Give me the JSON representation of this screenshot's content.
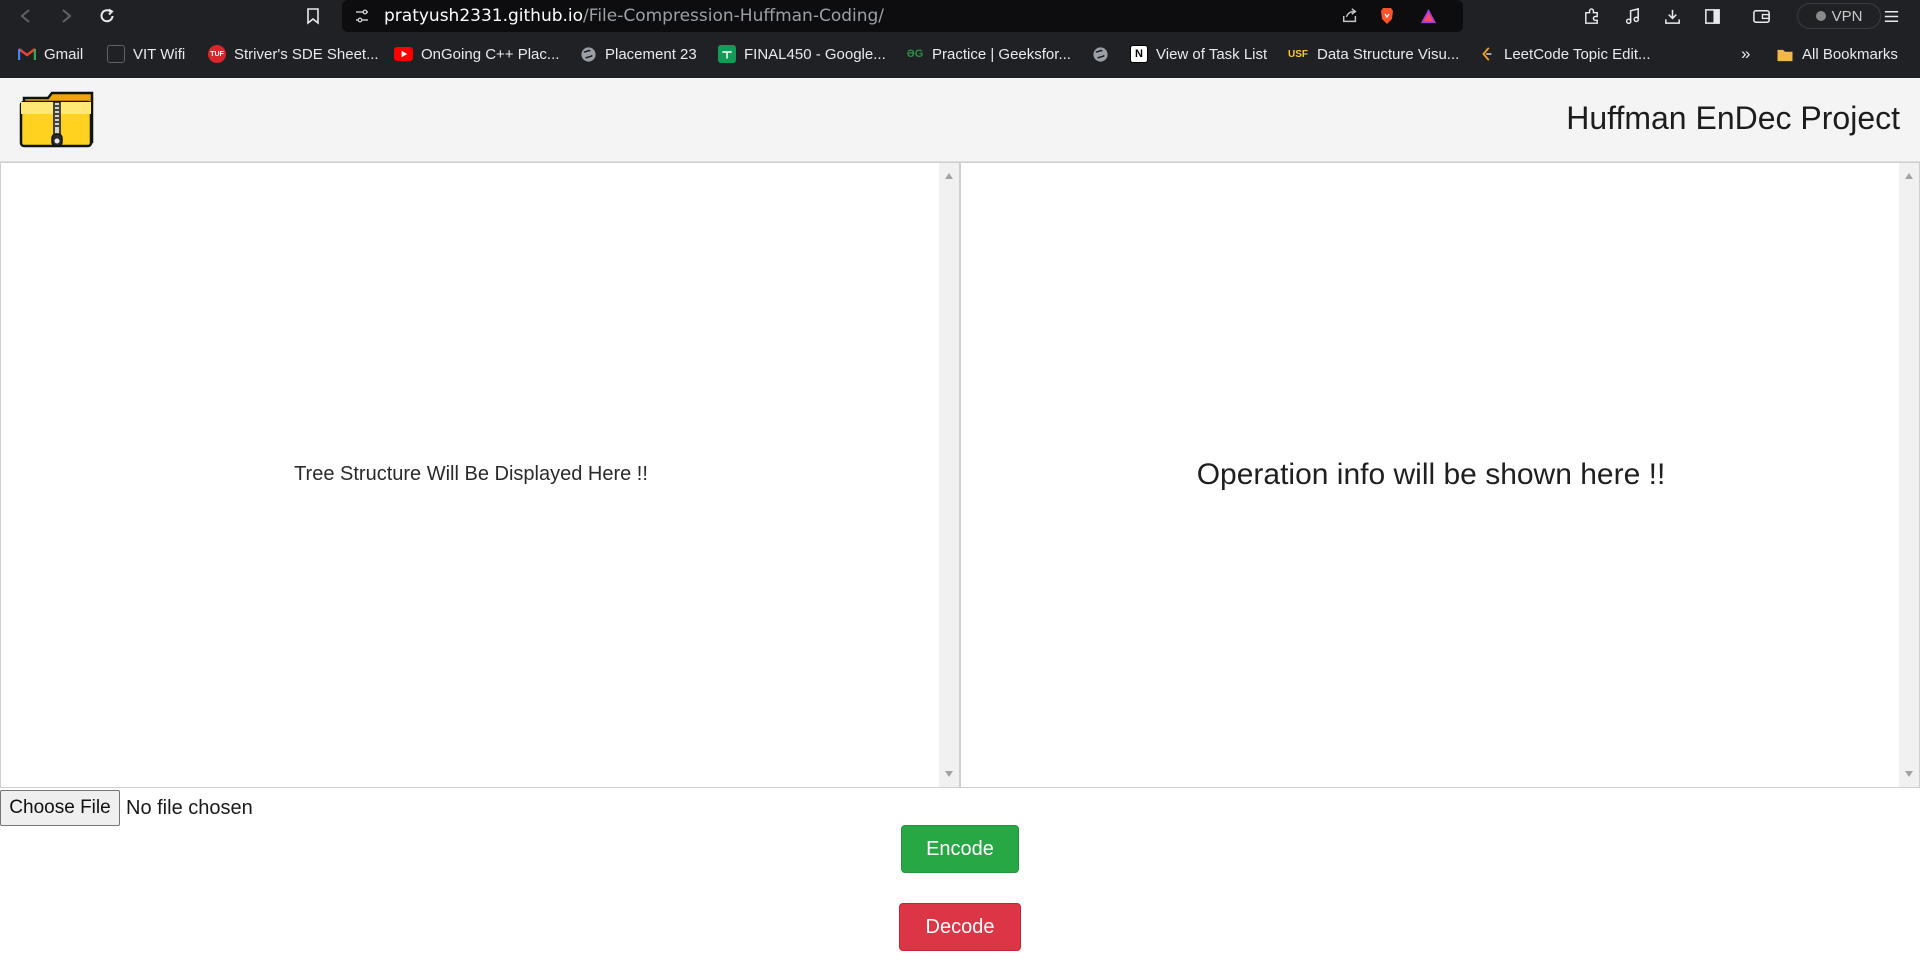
{
  "browser": {
    "url_domain": "pratyush2331.github.io",
    "url_path": "/File-Compression-Huffman-Coding/",
    "vpn_label": "VPN",
    "bookmarks": [
      {
        "label": "Gmail"
      },
      {
        "label": "VIT Wifi"
      },
      {
        "label": "Striver's SDE Sheet..."
      },
      {
        "label": "OnGoing C++ Plac..."
      },
      {
        "label": "Placement 23"
      },
      {
        "label": "FINAL450 - Google..."
      },
      {
        "label": "Practice | Geeksfor..."
      },
      {
        "label": "View of Task List"
      },
      {
        "label": "Data Structure Visu..."
      },
      {
        "label": "LeetCode Topic Edit..."
      }
    ],
    "more_bookmarks": "»",
    "all_bookmarks": "All Bookmarks"
  },
  "page": {
    "title": "Huffman EnDec Project",
    "tree_placeholder": "Tree Structure Will Be Displayed Here !!",
    "op_placeholder": "Operation info will be shown here !!",
    "choose_file_label": "Choose File",
    "file_status": "No file chosen",
    "encode_label": "Encode",
    "decode_label": "Decode"
  },
  "colors": {
    "encode": "#28a745",
    "decode": "#dc3545",
    "header_bg": "#f4f4f4"
  }
}
